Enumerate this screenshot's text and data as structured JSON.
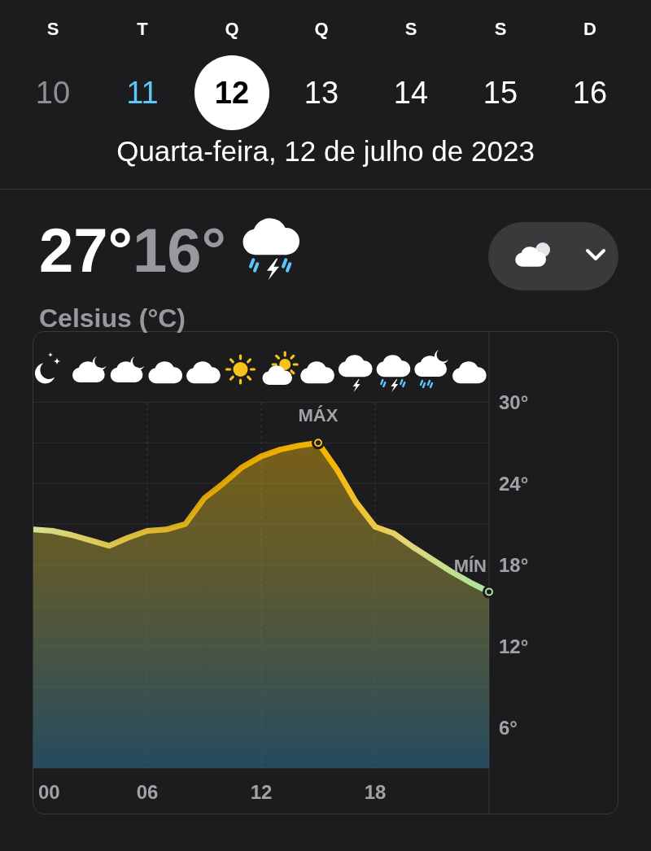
{
  "days": [
    {
      "weekday": "S",
      "date": "10",
      "past": true,
      "today": false,
      "selected": false
    },
    {
      "weekday": "T",
      "date": "11",
      "past": false,
      "today": true,
      "selected": false
    },
    {
      "weekday": "Q",
      "date": "12",
      "past": false,
      "today": false,
      "selected": true
    },
    {
      "weekday": "Q",
      "date": "13",
      "past": false,
      "today": false,
      "selected": false
    },
    {
      "weekday": "S",
      "date": "14",
      "past": false,
      "today": false,
      "selected": false
    },
    {
      "weekday": "S",
      "date": "15",
      "past": false,
      "today": false,
      "selected": false
    },
    {
      "weekday": "D",
      "date": "16",
      "past": false,
      "today": false,
      "selected": false
    }
  ],
  "selected_date": "Quarta-feira, 12 de julho de 2023",
  "summary": {
    "high": "27°",
    "low": "16°",
    "unit": "Celsius (°C)"
  },
  "chart": {
    "hourly_icons": [
      {
        "kind": "moon"
      },
      {
        "kind": "cloud-moon"
      },
      {
        "kind": "cloud-moon"
      },
      {
        "kind": "cloud"
      },
      {
        "kind": "cloud"
      },
      {
        "kind": "sun"
      },
      {
        "kind": "cloud-sun"
      },
      {
        "kind": "cloud"
      },
      {
        "kind": "cloud-bolt"
      },
      {
        "kind": "cloud-bolt-rain"
      },
      {
        "kind": "cloud-moon-rain"
      },
      {
        "kind": "cloud"
      }
    ],
    "chart_data": {
      "type": "area",
      "x": [
        0,
        1,
        2,
        3,
        4,
        5,
        6,
        7,
        8,
        9,
        10,
        11,
        12,
        13,
        14,
        15,
        16,
        17,
        18,
        19,
        20,
        21,
        22,
        23,
        24
      ],
      "series": [
        {
          "color": "#f7b500",
          "values": [
            20.6,
            20.5,
            20.2,
            19.8,
            19.4,
            20.0,
            20.5,
            20.6,
            21.0,
            22.9,
            24.0,
            25.2,
            26.0,
            26.5,
            26.8,
            27,
            25,
            22.6,
            20.8,
            20.3,
            19.3,
            18.4,
            17.5,
            16.7,
            16
          ]
        }
      ],
      "xlim": [
        0,
        24
      ],
      "ylim": [
        3,
        35
      ],
      "grid": true,
      "xticks": [
        {
          "value": 0,
          "label": "00"
        },
        {
          "value": 6,
          "label": "06"
        },
        {
          "value": 12,
          "label": "12"
        },
        {
          "value": 18,
          "label": "18"
        }
      ],
      "yticks": [
        {
          "value": 6,
          "label": "6°"
        },
        {
          "value": 12,
          "label": "12°"
        },
        {
          "value": 18,
          "label": "18°"
        },
        {
          "value": 24,
          "label": "24°"
        },
        {
          "value": 30,
          "label": "30°"
        }
      ],
      "annotations": [
        {
          "text": "MÁX"
        },
        {
          "text": "MÍN"
        }
      ]
    }
  }
}
